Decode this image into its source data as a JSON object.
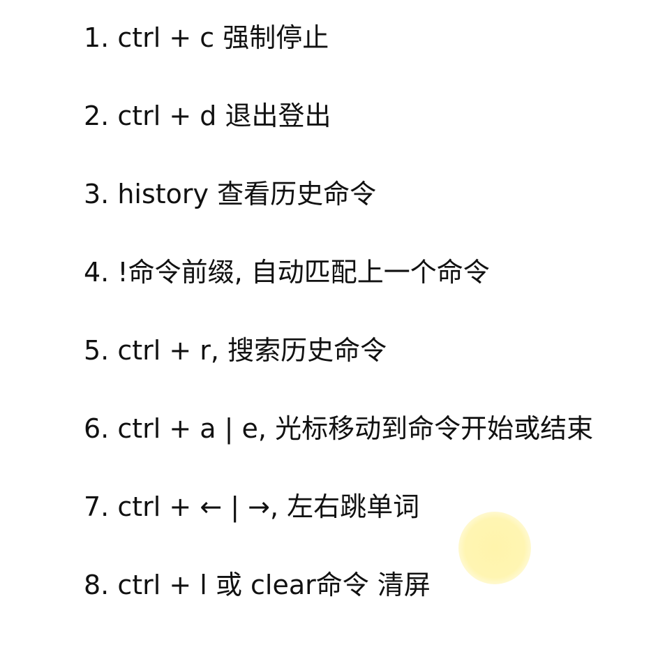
{
  "items": [
    "1. ctrl + c 强制停止",
    "2. ctrl + d 退出登出",
    "3. history 查看历史命令",
    "4. !命令前缀, 自动匹配上一个命令",
    "5. ctrl + r, 搜索历史命令",
    "6. ctrl + a | e, 光标移动到命令开始或结束",
    "7. ctrl + ← | →, 左右跳单词",
    "8. ctrl + l 或 clear命令 清屏"
  ],
  "colors": {
    "background": "#ffffff",
    "text": "#111111",
    "highlight": "#fff4aa"
  }
}
